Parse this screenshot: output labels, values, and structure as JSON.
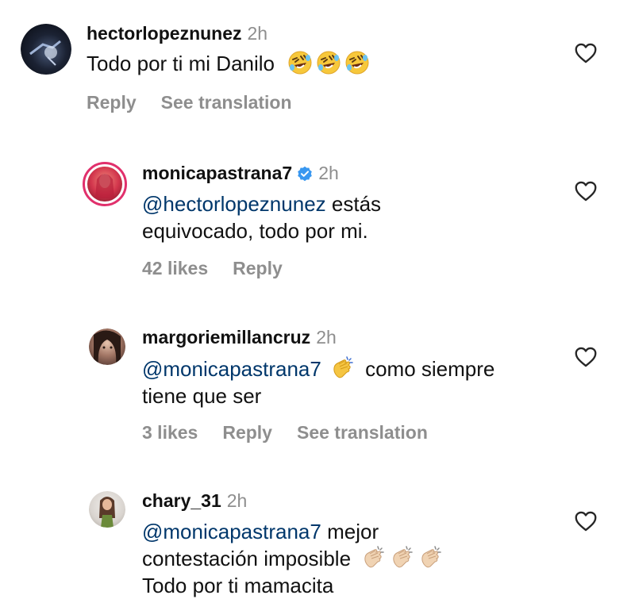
{
  "comments": [
    {
      "username": "hectorlopeznunez",
      "time": "2h",
      "text": "Todo por ti mi Danilo",
      "emoji": [
        "rofl-emoji",
        "rofl-emoji",
        "rofl-emoji"
      ],
      "actions": {
        "reply": "Reply",
        "translate": "See translation"
      }
    },
    {
      "username": "monicapastrana7",
      "verified": true,
      "time": "2h",
      "mention": "@hectorlopeznunez",
      "text_line1": " estás",
      "text_line2": "equivocado, todo por mi.",
      "actions": {
        "likes": "42 likes",
        "reply": "Reply"
      }
    },
    {
      "username": "margoriemillancruz",
      "time": "2h",
      "mention": "@monicapastrana7",
      "text_line1": " como siempre",
      "text_line2": "tiene que ser",
      "emoji": [
        "clapping-hands-emoji"
      ],
      "actions": {
        "likes": "3 likes",
        "reply": "Reply",
        "translate": "See translation"
      }
    },
    {
      "username": "chary_31",
      "time": "2h",
      "mention": "@monicapastrana7",
      "text_line1": " mejor",
      "text_line2": "contestación imposible",
      "text_line3": "Todo por ti mamacita",
      "emoji": [
        "clapping-hands-light-emoji",
        "clapping-hands-light-emoji",
        "clapping-hands-light-emoji"
      ]
    }
  ],
  "colors": {
    "mention": "#00376b",
    "secondary_text": "#8e8e8e",
    "verified": "#3897f0",
    "story_ring": "#e1306c"
  }
}
